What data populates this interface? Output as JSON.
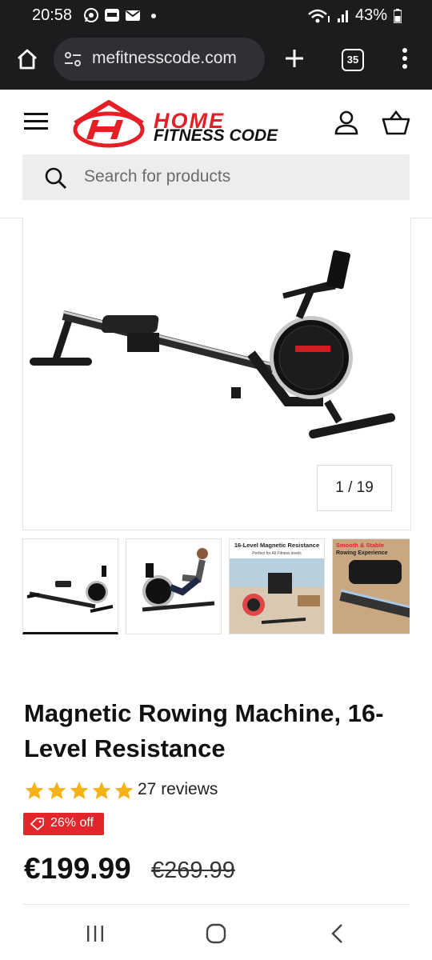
{
  "status_bar": {
    "time": "20:58",
    "battery": "43%",
    "icons": [
      "whatsapp-icon",
      "ring-icon",
      "mail-icon",
      "dot-icon",
      "wifi-icon",
      "signal-icon",
      "battery-icon"
    ]
  },
  "browser": {
    "url": "mefitnesscode.com",
    "tab_count": "35",
    "icons": [
      "home-icon",
      "site-settings-icon",
      "new-tab-icon",
      "more-icon"
    ]
  },
  "site": {
    "logo_line1": "HOME",
    "logo_line2": "FITNESS CODE",
    "search_placeholder": "Search for products",
    "brand_color": "#e41f26",
    "icons": [
      "menu-icon",
      "logo-mark",
      "account-icon",
      "cart-icon",
      "search-icon"
    ]
  },
  "gallery": {
    "counter": "1 / 19",
    "thumbnails": [
      {
        "label": "Rowing machine side view"
      },
      {
        "label": "Man using rowing machine"
      },
      {
        "title": "16-Level Magnetic Resistance",
        "subtitle": "Perfect for All Fitness levels"
      },
      {
        "title": "Smooth & Stable",
        "subtitle": "Rowing Experience"
      }
    ]
  },
  "product": {
    "title": "Magnetic Rowing Machine, 16-Level Resistance",
    "rating": 5,
    "reviews": "27 reviews",
    "badge": "26% off",
    "price": "€199.99",
    "old_price": "€269.99",
    "accent_color": "#e2262b",
    "star_color": "#f5b316"
  }
}
